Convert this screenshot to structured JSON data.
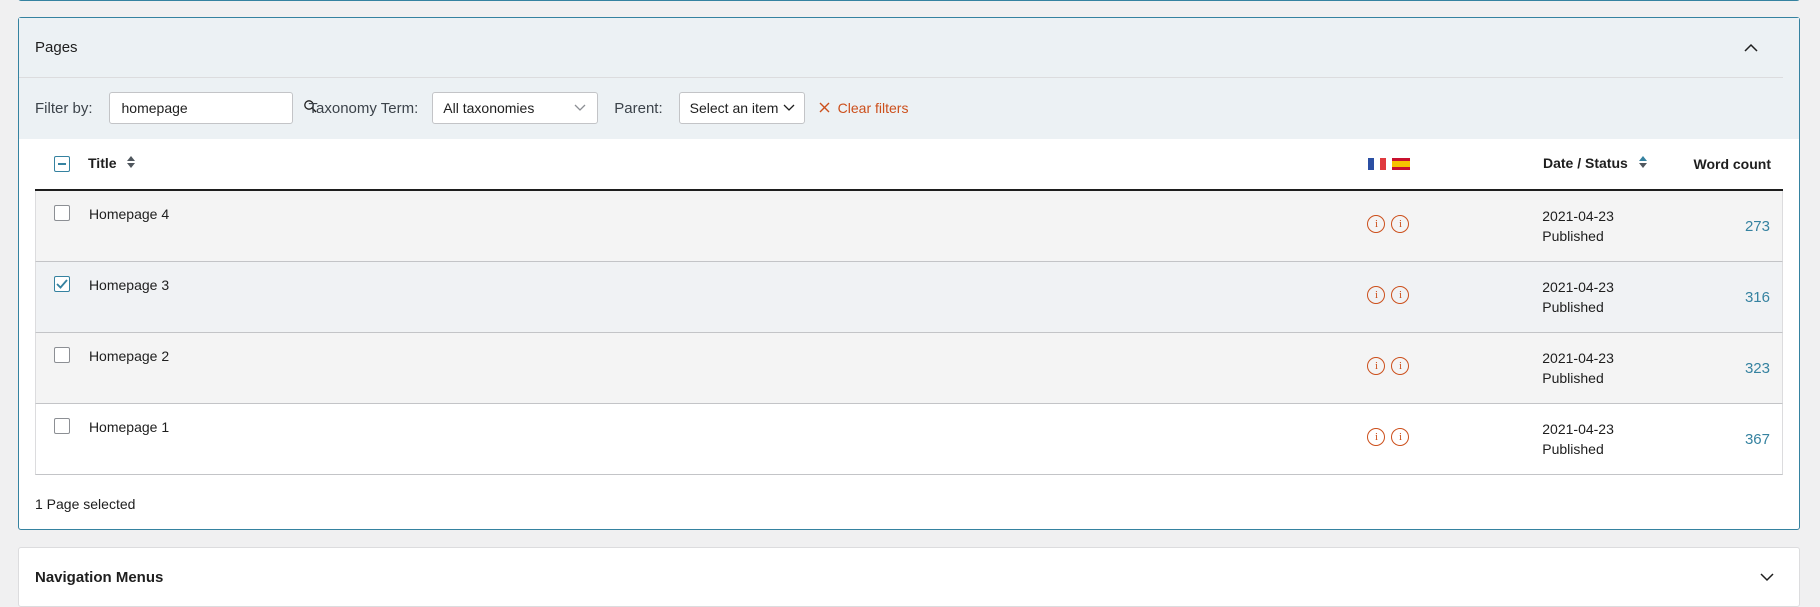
{
  "pages_panel": {
    "title": "Pages",
    "filters": {
      "filter_label": "Filter by:",
      "search_value": "homepage",
      "taxonomy_label": "Taxonomy Term:",
      "taxonomy_value": "All taxonomies",
      "parent_label": "Parent:",
      "parent_value": "Select an item",
      "clear_label": "Clear filters"
    },
    "columns": {
      "title": "Title",
      "date_status": "Date / Status",
      "word_count": "Word count"
    },
    "languages": [
      "fr-flag",
      "es-flag"
    ],
    "rows": [
      {
        "title": "Homepage 4",
        "date": "2021-04-23",
        "status": "Published",
        "word_count": "273",
        "checked": false
      },
      {
        "title": "Homepage 3",
        "date": "2021-04-23",
        "status": "Published",
        "word_count": "316",
        "checked": true
      },
      {
        "title": "Homepage 2",
        "date": "2021-04-23",
        "status": "Published",
        "word_count": "323",
        "checked": false
      },
      {
        "title": "Homepage 1",
        "date": "2021-04-23",
        "status": "Published",
        "word_count": "367",
        "checked": false
      }
    ],
    "selection_summary": "1 Page selected"
  },
  "navigation_panel": {
    "title": "Navigation Menus"
  },
  "colors": {
    "accent": "#3582a0",
    "warning": "#cc4f1b",
    "panel_bg": "#ecf1f4"
  }
}
